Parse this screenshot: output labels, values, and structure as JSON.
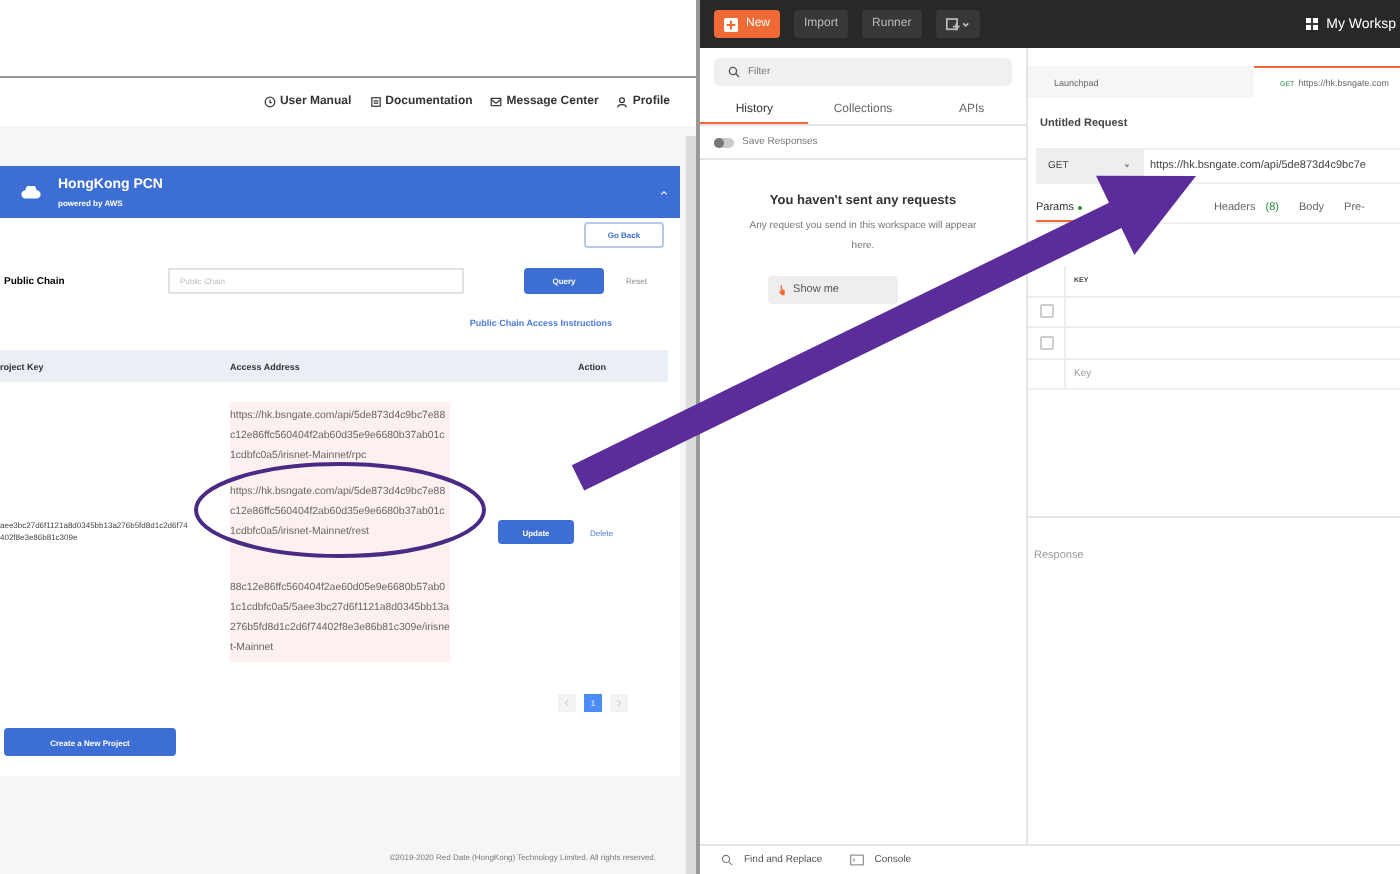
{
  "browser_page": {
    "nav_links": [
      {
        "kind": "clock",
        "label": "User Manual"
      },
      {
        "kind": "doc",
        "label": "Documentation"
      },
      {
        "kind": "mail",
        "label": "Message Center"
      },
      {
        "kind": "user",
        "label": "Profile"
      }
    ],
    "banner": {
      "title": "HongKong PCN",
      "subtitle": "powered by AWS"
    },
    "go_back": "Go Back",
    "filter": {
      "label": "Public Chain",
      "placeholder": "Public Chain"
    },
    "query_button": "Query",
    "reset_link": "Reset",
    "instructions_link": "Public Chain Access Instructions",
    "table": {
      "columns": [
        "roject Key",
        "Access Address",
        "Action"
      ],
      "rows": [
        {
          "project_key": "aee3bc27d6f1121a8d0345bb13a276b5fd8d1c2d6f74402f8e3e86b81c309e",
          "addresses": [
            "https://hk.bsngate.com/api/5de873d4c9bc7e88c12e86ffc560404f2ab60d35e9e6680b37ab01c1cdbfc0a5/irisnet-Mainnet/rpc",
            "https://hk.bsngate.com/api/5de873d4c9bc7e88c12e86ffc560404f2ab60d35e9e6680b37ab01c1cdbfc0a5/irisnet-Mainnet/rest",
            "88c12e86ffc560404f2ae60d05e9e6680b57ab01c1cdbfc0a5/5aee3bc27d6f1121a8d0345bb13a276b5fd8d1c2d6f74402f8e3e86b81c309e/irisnet-Mainnet"
          ],
          "actions": [
            "Update",
            "Delete"
          ]
        }
      ]
    },
    "pagination": [
      {
        "label": "1",
        "selected": true
      }
    ],
    "create_button": "Create a New Project",
    "footer": "©2019-2020 Red Date (HongKong) Technology Limited. All rights reserved."
  },
  "postman": {
    "toolbar": {
      "new_button": "New",
      "buttons": [
        "Import",
        "Runner"
      ],
      "workspace": "My Worksp"
    },
    "sidebar": {
      "filter_placeholder": "Filter",
      "tabs": [
        {
          "label": "History",
          "selected": true
        },
        {
          "label": "Collections",
          "selected": false
        },
        {
          "label": "APIs",
          "selected": false
        }
      ],
      "save_responses": {
        "label": "Save Responses",
        "on": false
      },
      "empty_title": "You haven't sent any requests",
      "empty_text": "Any request you send in this workspace will appear here.",
      "show_me_button": "Show me"
    },
    "tabs": [
      {
        "label": "Launchpad",
        "selected": false
      },
      {
        "method": "GET",
        "label": "https://hk.bsngate.com",
        "selected": true
      }
    ],
    "request_title": "Untitled Request",
    "method": "GET",
    "url": "https://hk.bsngate.com/api/5de873d4c9bc7e",
    "param_tabs": [
      {
        "label": "Params",
        "selected": true,
        "dot": true
      },
      {
        "label": "Headers",
        "count": "(8)",
        "selected": false,
        "dot": false
      },
      {
        "label": "Body",
        "selected": false,
        "dot": false
      },
      {
        "label": "Pre-",
        "selected": false,
        "dot": false
      }
    ],
    "key_header": "KEY",
    "param_rows": [
      {
        "checked": false
      },
      {
        "checked": false
      }
    ],
    "key_placeholder": "Key",
    "response_label": "Response",
    "status_bar": [
      {
        "kind": "search",
        "label": "Find and Replace"
      },
      {
        "kind": "console",
        "label": "Console"
      }
    ]
  }
}
